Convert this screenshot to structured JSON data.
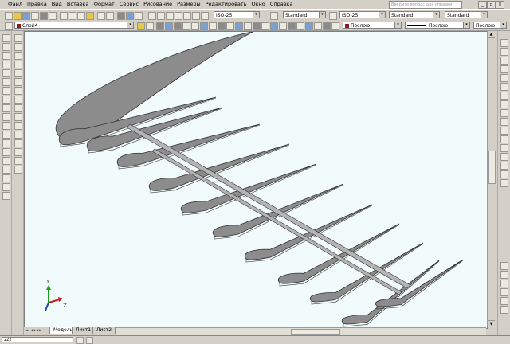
{
  "menu": [
    "Файл",
    "Правка",
    "Вид",
    "Вставка",
    "Формат",
    "Сервис",
    "Рисование",
    "Размеры",
    "Редактировать",
    "Окно",
    "Справка"
  ],
  "help_placeholder": "Введите вопрос для справки",
  "toolbar_top": {
    "dimstyle_value": "ISO-25",
    "textstyle_value": "Standard",
    "dimstyle2_value": "ISO-25",
    "tablestyle_value": "Standard",
    "mleaderstyle_value": "Standard"
  },
  "toolbar_layers": {
    "layer_value": "Слой4",
    "color_value": "Послою",
    "linetype_value": "Послою",
    "lineweight_value": "Послою"
  },
  "tabs": [
    "Модель",
    "Лист1",
    "Лист2"
  ],
  "command_line_value": "222",
  "ucs_axes": {
    "y": "Y",
    "z": "Z"
  },
  "colors": {
    "viewport_bg": "#f2fbfb",
    "rib_fill": "#8c8c8c",
    "rib_stroke": "#333333",
    "layer_red": "#8b1a1a"
  }
}
